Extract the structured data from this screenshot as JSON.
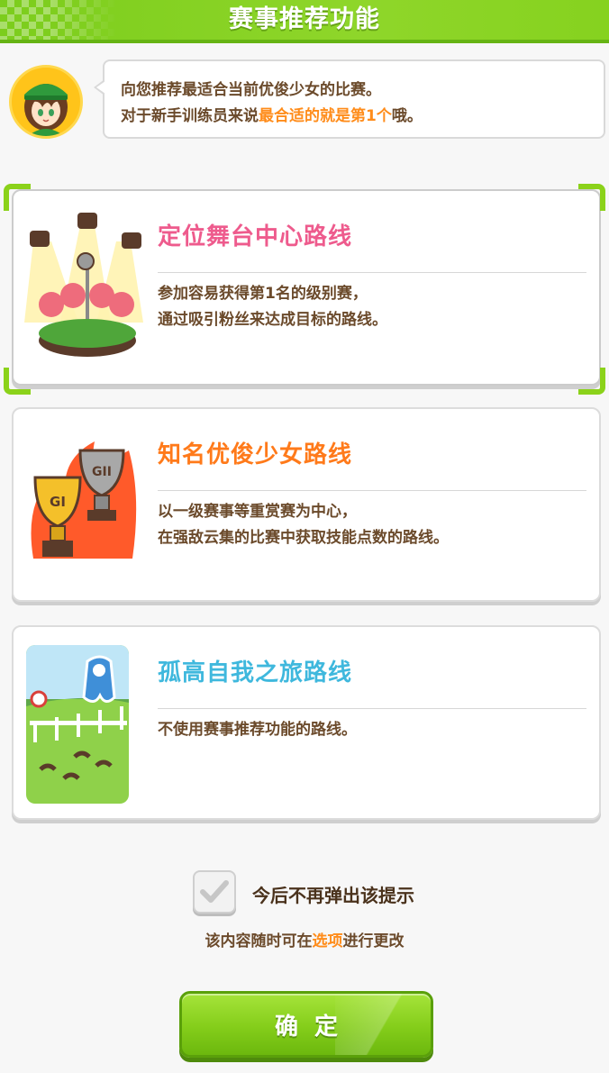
{
  "header": {
    "title": "赛事推荐功能"
  },
  "trainer": {
    "line1": "向您推荐最适合当前优俊少女的比赛。",
    "line2_prefix": "对于新手训练员来说",
    "line2_highlight": "最合适的就是第1个",
    "line2_suffix": "哦。"
  },
  "routes": [
    {
      "title": "定位舞台中心路线",
      "title_color": "#ee5b8d",
      "desc_line1": "参加容易获得第1名的级别赛，",
      "desc_line2": "通过吸引粉丝来达成目标的路线。",
      "icon": "stage-microphone-icon",
      "selected": true
    },
    {
      "title": "知名优俊少女路线",
      "title_color": "#ff7a1a",
      "desc_line1": "以一级赛事等重赏赛为中心，",
      "desc_line2": "在强敌云集的比赛中获取技能点数的路线。",
      "icon": "trophy-icon",
      "trophy_gold_label": "GI",
      "trophy_silver_label": "GII"
    },
    {
      "title": "孤高自我之旅路线",
      "title_color": "#3fb8dd",
      "desc_line1": "不使用赛事推荐功能的路线。",
      "icon": "racetrack-icon"
    }
  ],
  "dont_show": {
    "label": "今后不再弹出该提示",
    "checked": true
  },
  "note": {
    "prefix": "该内容随时可在",
    "link": "选项",
    "suffix": "进行更改"
  },
  "confirm": {
    "label": "确定"
  },
  "colors": {
    "accent_green": "#8bd21a",
    "highlight_orange": "#ff8c1a",
    "text_brown": "#6b4a2b"
  }
}
